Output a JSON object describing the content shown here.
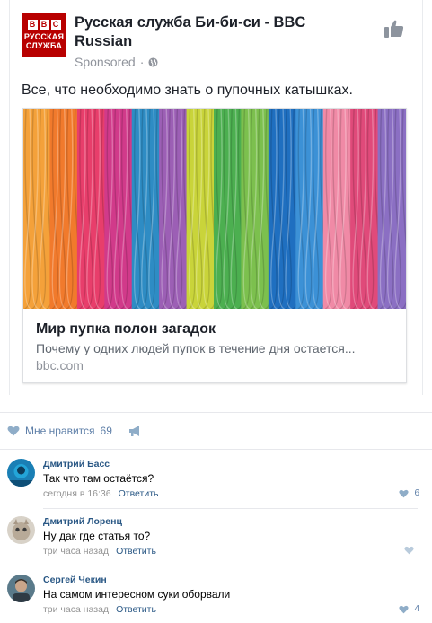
{
  "ad": {
    "logo_lines": [
      "РУССКАЯ",
      "СЛУЖБА"
    ],
    "logo_letters": [
      "B",
      "B",
      "C"
    ],
    "page_name": "Русская служба Би-би-си - BBC Russian",
    "sponsored_label": "Sponsored",
    "sponsored_sep": "·",
    "post_text": "Все, что необходимо знать о пупочных катышках.",
    "link_title": "Мир пупка полон загадок",
    "link_description": "Почему у одних людей пупок в течение дня остается...",
    "link_domain": "bbc.com",
    "icons": [
      "globe-icon",
      "like-icon"
    ],
    "yarn_colors": [
      "#f4a13a",
      "#f17a2c",
      "#e83e6b",
      "#d13a8a",
      "#2e8cc4",
      "#9c5fb5",
      "#c9d43a",
      "#4caf50",
      "#7cc04e",
      "#1f6fc0",
      "#3c91d6",
      "#f08aa6",
      "#e04a7a",
      "#8b6fc3"
    ]
  },
  "vk": {
    "like_label": "Мне нравится",
    "like_count": "69",
    "comments": [
      {
        "author": "Дмитрий Басс",
        "text": "Так что там остаётся?",
        "time": "сегодня в 16:36",
        "reply": "Ответить",
        "likes": "6"
      },
      {
        "author": "Дмитрий Лоренц",
        "text": "Ну дак где статья то?",
        "time": "три часа назад",
        "reply": "Ответить",
        "likes": ""
      },
      {
        "author": "Сергей Чекин",
        "text": "На самом интересном суки оборвали",
        "time": "три часа назад",
        "reply": "Ответить",
        "likes": "4"
      }
    ]
  },
  "colors": {
    "link_blue": "#2a5885",
    "like_blue": "#5e7fa8",
    "bbc_red": "#b80000"
  }
}
